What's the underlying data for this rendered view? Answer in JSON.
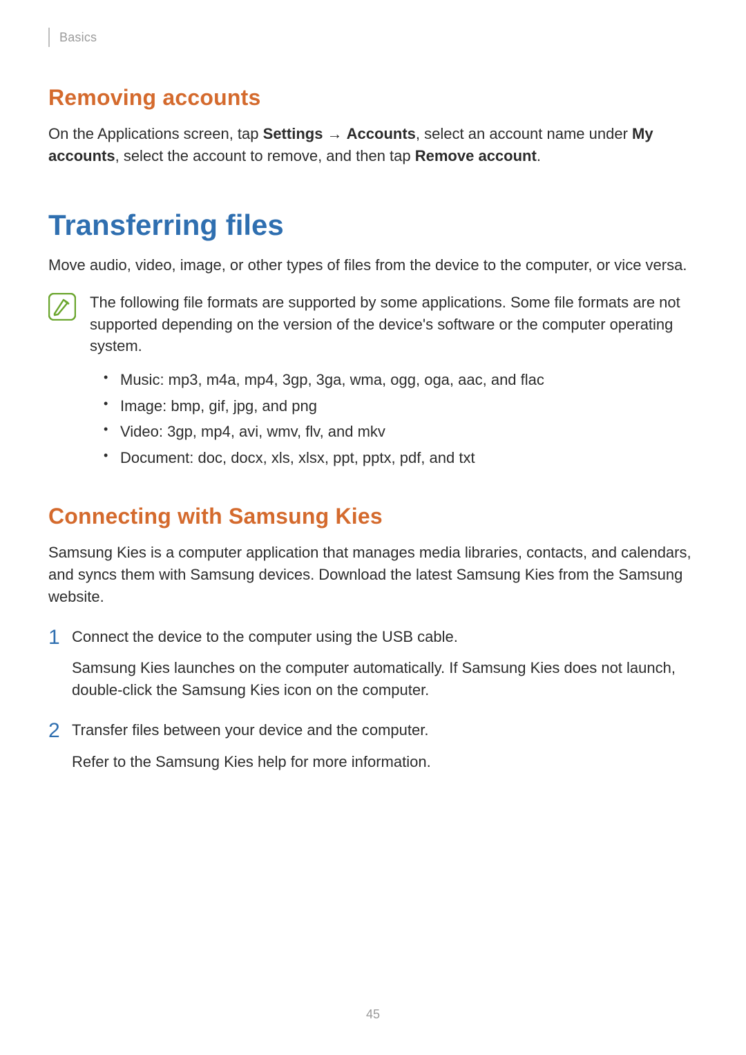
{
  "header": {
    "section": "Basics"
  },
  "removing": {
    "heading": "Removing accounts",
    "p1a": "On the Applications screen, tap ",
    "settings": "Settings",
    "arrow": " → ",
    "accounts": "Accounts",
    "p1b": ", select an account name under ",
    "my_accounts": "My accounts",
    "p1c": ", select the account to remove, and then tap ",
    "remove_account": "Remove account",
    "p1d": "."
  },
  "transferring": {
    "heading": "Transferring files",
    "intro": "Move audio, video, image, or other types of files from the device to the computer, or vice versa.",
    "note": "The following file formats are supported by some applications. Some file formats are not supported depending on the version of the device's software or the computer operating system.",
    "formats": [
      "Music: mp3, m4a, mp4, 3gp, 3ga, wma, ogg, oga, aac, and flac",
      "Image: bmp, gif, jpg, and png",
      "Video: 3gp, mp4, avi, wmv, flv, and mkv",
      "Document: doc, docx, xls, xlsx, ppt, pptx, pdf, and txt"
    ]
  },
  "kies": {
    "heading": "Connecting with Samsung Kies",
    "intro": "Samsung Kies is a computer application that manages media libraries, contacts, and calendars, and syncs them with Samsung devices. Download the latest Samsung Kies from the Samsung website.",
    "steps": [
      {
        "num": "1",
        "main": "Connect the device to the computer using the USB cable.",
        "sub": "Samsung Kies launches on the computer automatically. If Samsung Kies does not launch, double-click the Samsung Kies icon on the computer."
      },
      {
        "num": "2",
        "main": "Transfer files between your device and the computer.",
        "sub": "Refer to the Samsung Kies help for more information."
      }
    ]
  },
  "page_number": "45"
}
